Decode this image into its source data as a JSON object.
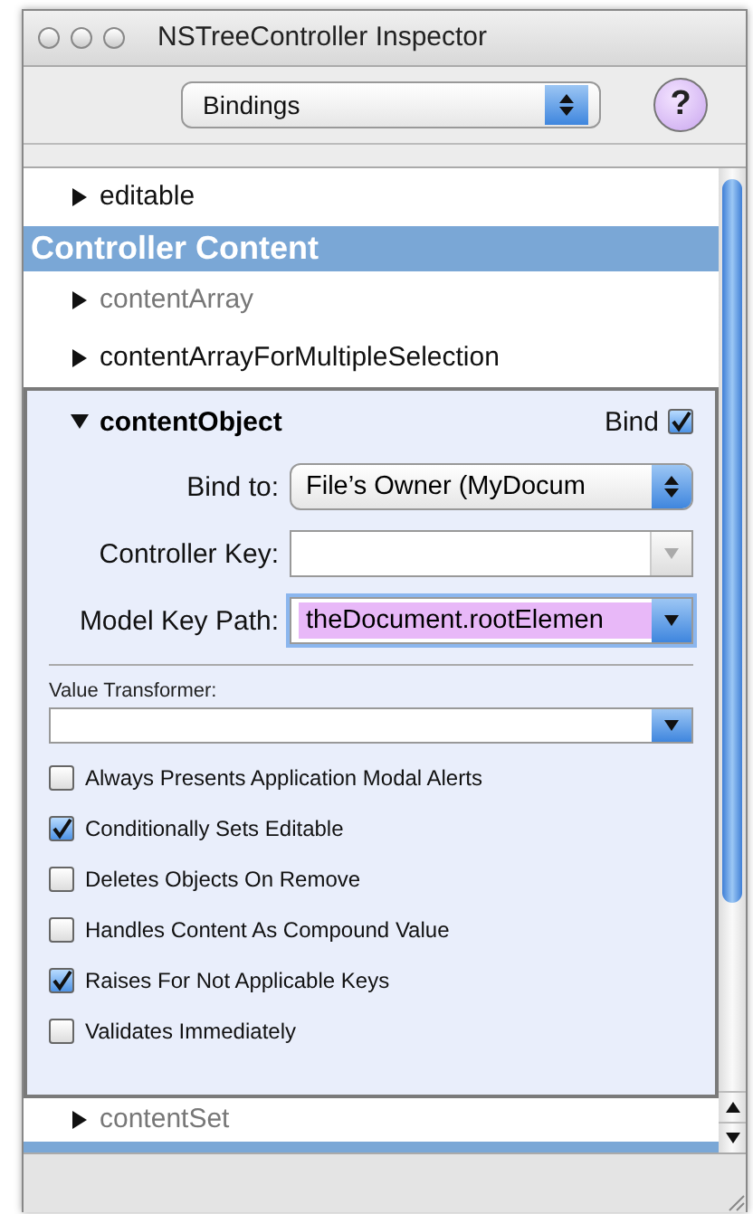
{
  "window": {
    "title": "NSTreeController Inspector"
  },
  "toolbar": {
    "popup": "Bindings",
    "help": "?"
  },
  "bindings": [
    {
      "kind": "binding",
      "name": "editable",
      "dimmed": false,
      "expanded": false
    },
    {
      "kind": "header",
      "label": "Controller Content"
    },
    {
      "kind": "binding",
      "name": "contentArray",
      "dimmed": true,
      "expanded": false
    },
    {
      "kind": "binding",
      "name": "contentArrayForMultipleSelection",
      "dimmed": false,
      "expanded": false
    },
    {
      "kind": "binding",
      "name": "contentObject",
      "expanded": true,
      "bind_label": "Bind",
      "bound": true,
      "fields": [
        {
          "kind": "popup",
          "label": "Bind to:",
          "value": "File’s Owner (MyDocum",
          "disabled": false,
          "text_selected": false
        },
        {
          "kind": "combo",
          "label": "Controller Key:",
          "disabled": true,
          "text_selected": false
        },
        {
          "kind": "combo",
          "label": "Model Key Path:",
          "value": "theDocument.rootElemen",
          "disabled": false,
          "text_selected": true
        }
      ],
      "transformer": {
        "label": "Value Transformer:",
        "disabled": false
      },
      "options": [
        {
          "label": "Always Presents Application Modal Alerts",
          "checked": false
        },
        {
          "label": "Conditionally Sets Editable",
          "checked": true
        },
        {
          "label": "Deletes Objects On Remove",
          "checked": false
        },
        {
          "label": "Handles Content As Compound Value",
          "checked": false
        },
        {
          "label": "Raises For Not Applicable Keys",
          "checked": true
        },
        {
          "label": "Validates Immediately",
          "checked": false
        }
      ]
    },
    {
      "kind": "binding",
      "name": "contentSet",
      "dimmed": true,
      "expanded": false
    },
    {
      "kind": "header"
    }
  ]
}
